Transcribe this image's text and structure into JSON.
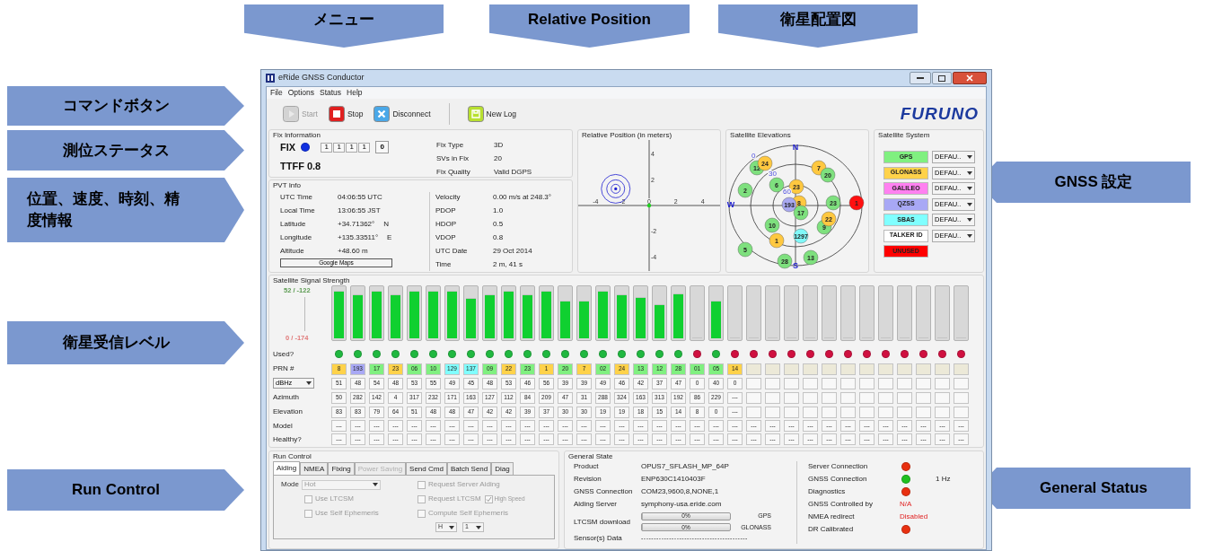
{
  "callouts": [
    {
      "text": "メニュー",
      "kind": "down"
    },
    {
      "text": "Relative Position",
      "kind": "down"
    },
    {
      "text": "衛星配置図",
      "kind": "down"
    },
    {
      "text": "コマンドボタン",
      "kind": "right"
    },
    {
      "text": "測位ステータス",
      "kind": "right"
    },
    {
      "text": "位置、速度、時刻、精度情報",
      "kind": "right"
    },
    {
      "text": "衛星受信レベル",
      "kind": "right"
    },
    {
      "text": "Run Control",
      "kind": "right"
    },
    {
      "text": "GNSS 設定",
      "kind": "left"
    },
    {
      "text": "General Status",
      "kind": "left"
    }
  ],
  "window": {
    "title": "eRide GNSS Conductor"
  },
  "menu": [
    "File",
    "Options",
    "Status",
    "Help"
  ],
  "toolbar": [
    {
      "label": "Start",
      "kind": "start",
      "disabled": true
    },
    {
      "label": "Stop",
      "kind": "stop",
      "disabled": false
    },
    {
      "label": "Disconnect",
      "kind": "disconnect",
      "disabled": false
    },
    {
      "label": "New Log",
      "kind": "log",
      "disabled": false
    }
  ],
  "logo": "FURUNO",
  "fix_information": {
    "title": "Fix Information",
    "status": "FIX",
    "boxes": [
      "1",
      "1",
      "1",
      "1"
    ],
    "count": "0",
    "ttff": "TTFF 0.8",
    "fields": [
      {
        "label": "Fix Type",
        "value": "3D"
      },
      {
        "label": "SVs in Fix",
        "value": "20"
      },
      {
        "label": "Fix Quality",
        "value": "Valid DGPS"
      }
    ]
  },
  "pvt_info": {
    "title": "PVT Info",
    "left": [
      {
        "label": "UTC Time",
        "value": "04:06:55 UTC"
      },
      {
        "label": "Local Time",
        "value": "13:06:55 JST"
      },
      {
        "label": "Latitude",
        "value": "+34.71362°",
        "suffix": "N"
      },
      {
        "label": "Longitude",
        "value": "+135.33511°",
        "suffix": "E"
      },
      {
        "label": "Altitude",
        "value": "+48.60 m"
      }
    ],
    "button": "Google Maps",
    "right": [
      {
        "label": "Velocity",
        "value": "0.00 m/s at 248.3°"
      },
      {
        "label": "PDOP",
        "value": "1.0"
      },
      {
        "label": "HDOP",
        "value": "0.5"
      },
      {
        "label": "VDOP",
        "value": "0.8"
      },
      {
        "label": "UTC Date",
        "value": "29 Oct 2014"
      },
      {
        "label": "Time",
        "value": "2 m, 41 s"
      }
    ]
  },
  "relative_position": {
    "chart_data": {
      "type": "scatter",
      "title": "Relative Position (in meters)",
      "x": [
        -2.5
      ],
      "series": [
        {
          "color": "#2020d0",
          "values": [
            1.3
          ]
        }
      ],
      "xlim": [
        -5.3,
        5.3
      ],
      "ylim": [
        -5.1,
        5.1
      ],
      "xticks": [
        -4,
        -2,
        0,
        2,
        4
      ],
      "yticks": [
        4,
        2,
        -2,
        -4
      ]
    }
  },
  "satellite_elevations": {
    "title": "Satellite Elevations",
    "directions": [
      "N",
      "W",
      "S"
    ],
    "rings": [
      "0",
      "30",
      "60"
    ],
    "satellites": [
      {
        "label": "12",
        "color": "#7ee07e"
      },
      {
        "label": "24",
        "color": "#ffc840"
      },
      {
        "label": "7",
        "color": "#ffc840"
      },
      {
        "label": "20",
        "color": "#7ee07e"
      },
      {
        "label": "2",
        "color": "#7ee07e"
      },
      {
        "label": "6",
        "color": "#7ee07e"
      },
      {
        "label": "8",
        "color": "#ffc840"
      },
      {
        "label": "17",
        "color": "#7ee07e"
      },
      {
        "label": "23",
        "color": "#ffc840"
      },
      {
        "label": "193",
        "color": "#a8a8f0"
      },
      {
        "label": "23",
        "color": "#7ee07e"
      },
      {
        "label": "1",
        "color": "#ff1010"
      },
      {
        "label": "9",
        "color": "#7ee07e"
      },
      {
        "label": "22",
        "color": "#ffc840"
      },
      {
        "label": "10",
        "color": "#7ee07e"
      },
      {
        "label": "1",
        "color": "#ffc840"
      },
      {
        "label": "1297",
        "color": "#80f8f8"
      },
      {
        "label": "5",
        "color": "#7ee07e"
      },
      {
        "label": "28",
        "color": "#7ee07e"
      },
      {
        "label": "13",
        "color": "#7ee07e"
      }
    ]
  },
  "satellite_system": {
    "title": "Satellite System",
    "systems": [
      {
        "name": "GPS",
        "color": "#80f080",
        "setting": "DEFAU.."
      },
      {
        "name": "GLONASS",
        "color": "#ffd24a",
        "setting": "DEFAU.."
      },
      {
        "name": "GALILEO",
        "color": "#ff80f0",
        "setting": "DEFAU.."
      },
      {
        "name": "QZSS",
        "color": "#a8a8f5",
        "setting": "DEFAU.."
      },
      {
        "name": "SBAS",
        "color": "#80ffff",
        "setting": "DEFAU.."
      },
      {
        "name": "TALKER ID",
        "color": "#ffffff",
        "setting": "DEFAU.."
      },
      {
        "name": "UNUSED",
        "color": "#ff0000"
      }
    ]
  },
  "signal_strength": {
    "title": "Satellite Signal Strength",
    "scale_top": "52 / -122",
    "scale_bottom": "0 / -174",
    "row_labels": {
      "used": "Used?",
      "prn": "PRN #",
      "unit": "dBHz",
      "azimuth": "Azimuth",
      "elevation": "Elevation",
      "model": "Model",
      "healthy": "Healthy?"
    },
    "satellites": [
      {
        "prn": "8",
        "color": "#ffd24a",
        "used": true,
        "level": 0.95,
        "cn0": "51",
        "azimuth": "50",
        "elevation": "83",
        "model": "---",
        "healthy": "---"
      },
      {
        "prn": "193",
        "color": "#a8a8f5",
        "used": true,
        "level": 0.88,
        "cn0": "48",
        "azimuth": "282",
        "elevation": "83",
        "model": "---",
        "healthy": "---"
      },
      {
        "prn": "17",
        "color": "#80f080",
        "used": true,
        "level": 0.95,
        "cn0": "54",
        "azimuth": "142",
        "elevation": "79",
        "model": "---",
        "healthy": "---"
      },
      {
        "prn": "23",
        "color": "#ffd24a",
        "used": true,
        "level": 0.88,
        "cn0": "48",
        "azimuth": "4",
        "elevation": "64",
        "model": "---",
        "healthy": "---"
      },
      {
        "prn": "06",
        "color": "#80f080",
        "used": true,
        "level": 0.95,
        "cn0": "53",
        "azimuth": "317",
        "elevation": "51",
        "model": "---",
        "healthy": "---"
      },
      {
        "prn": "10",
        "color": "#80f080",
        "used": true,
        "level": 0.95,
        "cn0": "55",
        "azimuth": "232",
        "elevation": "48",
        "model": "---",
        "healthy": "---"
      },
      {
        "prn": "129",
        "color": "#80ffff",
        "used": true,
        "level": 0.95,
        "cn0": "49",
        "azimuth": "171",
        "elevation": "48",
        "model": "---",
        "healthy": "---"
      },
      {
        "prn": "137",
        "color": "#80ffff",
        "used": true,
        "level": 0.8,
        "cn0": "45",
        "azimuth": "163",
        "elevation": "47",
        "model": "---",
        "healthy": "---"
      },
      {
        "prn": "09",
        "color": "#80f080",
        "used": true,
        "level": 0.88,
        "cn0": "48",
        "azimuth": "127",
        "elevation": "42",
        "model": "---",
        "healthy": "---"
      },
      {
        "prn": "22",
        "color": "#ffd24a",
        "used": true,
        "level": 0.95,
        "cn0": "53",
        "azimuth": "112",
        "elevation": "42",
        "model": "---",
        "healthy": "---"
      },
      {
        "prn": "23",
        "color": "#80f080",
        "used": true,
        "level": 0.88,
        "cn0": "46",
        "azimuth": "84",
        "elevation": "39",
        "model": "---",
        "healthy": "---"
      },
      {
        "prn": "1",
        "color": "#ffd24a",
        "used": true,
        "level": 0.95,
        "cn0": "56",
        "azimuth": "209",
        "elevation": "37",
        "model": "---",
        "healthy": "---"
      },
      {
        "prn": "20",
        "color": "#80f080",
        "used": true,
        "level": 0.75,
        "cn0": "39",
        "azimuth": "47",
        "elevation": "30",
        "model": "---",
        "healthy": "---"
      },
      {
        "prn": "7",
        "color": "#ffd24a",
        "used": true,
        "level": 0.75,
        "cn0": "39",
        "azimuth": "31",
        "elevation": "30",
        "model": "---",
        "healthy": "---"
      },
      {
        "prn": "02",
        "color": "#80f080",
        "used": true,
        "level": 0.95,
        "cn0": "49",
        "azimuth": "288",
        "elevation": "19",
        "model": "---",
        "healthy": "---"
      },
      {
        "prn": "24",
        "color": "#ffd24a",
        "used": true,
        "level": 0.88,
        "cn0": "46",
        "azimuth": "324",
        "elevation": "19",
        "model": "---",
        "healthy": "---"
      },
      {
        "prn": "13",
        "color": "#80f080",
        "used": true,
        "level": 0.82,
        "cn0": "42",
        "azimuth": "163",
        "elevation": "18",
        "model": "---",
        "healthy": "---"
      },
      {
        "prn": "12",
        "color": "#80f080",
        "used": true,
        "level": 0.67,
        "cn0": "37",
        "azimuth": "313",
        "elevation": "15",
        "model": "---",
        "healthy": "---"
      },
      {
        "prn": "28",
        "color": "#80f080",
        "used": true,
        "level": 0.9,
        "cn0": "47",
        "azimuth": "192",
        "elevation": "14",
        "model": "---",
        "healthy": "---"
      },
      {
        "prn": "01",
        "color": "#80f080",
        "used": false,
        "level": 0,
        "cn0": "0",
        "azimuth": "86",
        "elevation": "8",
        "model": "---",
        "healthy": "---"
      },
      {
        "prn": "05",
        "color": "#80f080",
        "used": true,
        "level": 0.75,
        "cn0": "40",
        "azimuth": "229",
        "elevation": "0",
        "model": "---",
        "healthy": "---"
      },
      {
        "prn": "14",
        "color": "#ffd24a",
        "used": false,
        "level": 0,
        "cn0": "0",
        "azimuth": "---",
        "elevation": "---",
        "model": "---",
        "healthy": "---"
      },
      {
        "color": "#ece9d8",
        "used": false,
        "level": 0,
        "model": "---",
        "healthy": "---"
      },
      {
        "color": "#ece9d8",
        "used": false,
        "level": 0,
        "model": "---",
        "healthy": "---"
      },
      {
        "color": "#ece9d8",
        "used": false,
        "level": 0,
        "model": "---",
        "healthy": "---"
      },
      {
        "color": "#ece9d8",
        "used": false,
        "level": 0,
        "model": "---",
        "healthy": "---"
      },
      {
        "color": "#ece9d8",
        "used": false,
        "level": 0,
        "model": "---",
        "healthy": "---"
      },
      {
        "color": "#ece9d8",
        "used": false,
        "level": 0,
        "model": "---",
        "healthy": "---"
      },
      {
        "color": "#ece9d8",
        "used": false,
        "level": 0,
        "model": "---",
        "healthy": "---"
      },
      {
        "color": "#ece9d8",
        "used": false,
        "level": 0,
        "model": "---",
        "healthy": "---"
      },
      {
        "color": "#ece9d8",
        "used": false,
        "level": 0,
        "model": "---",
        "healthy": "---"
      },
      {
        "color": "#ece9d8",
        "used": false,
        "level": 0,
        "model": "---",
        "healthy": "---"
      },
      {
        "color": "#ece9d8",
        "used": false,
        "level": 0,
        "model": "---",
        "healthy": "---"
      },
      {
        "color": "#ece9d8",
        "used": false,
        "level": 0,
        "model": "---",
        "healthy": "---"
      }
    ]
  },
  "run_control": {
    "title": "Run Control",
    "tabs": [
      {
        "label": "Aiding",
        "selected": true,
        "disabled": false
      },
      {
        "label": "NMEA",
        "selected": false,
        "disabled": false
      },
      {
        "label": "Fixing",
        "selected": false,
        "disabled": false
      },
      {
        "label": "Power Saving",
        "selected": false,
        "disabled": true
      },
      {
        "label": "Send Cmd",
        "selected": false,
        "disabled": false
      },
      {
        "label": "Batch Send",
        "selected": false,
        "disabled": false
      },
      {
        "label": "Diag",
        "selected": false,
        "disabled": false
      }
    ],
    "mode": {
      "label": "Mode",
      "value": "Hot"
    },
    "options_left": [
      {
        "label": "Use LTCSM",
        "checked": false
      },
      {
        "label": "Use Self Ephemeris",
        "checked": false
      }
    ],
    "options_right": [
      {
        "label": "Request Server Aiding",
        "checked": false
      },
      {
        "label": "Request LTCSM",
        "checked": false
      },
      {
        "label": "Compute Self Ephemeris",
        "checked": false
      }
    ],
    "high_speed": {
      "label": "High Speed",
      "checked": true
    },
    "selects": [
      "H",
      "1"
    ]
  },
  "general_state": {
    "title": "General State",
    "info": [
      {
        "label": "Product",
        "value": "OPUS7_SFLASH_MP_64P"
      },
      {
        "label": "Revision",
        "value": "ENP630C1410403F"
      },
      {
        "label": "GNSS Connection",
        "value": "COM23,9600,8,NONE,1"
      },
      {
        "label": "Aiding Server",
        "value": "symphony-usa.eride.com"
      }
    ],
    "download": {
      "label": "LTCSM download",
      "bars": [
        {
          "text": "0%",
          "level": 0,
          "system": "GPS"
        },
        {
          "text": "0%",
          "level": 0,
          "system": "GLONASS"
        }
      ]
    },
    "sensor": {
      "label": "Sensor(s) Data",
      "value": "------------------------------------------"
    },
    "status": [
      {
        "label": "Server Connection",
        "kind": "dot",
        "color": "#e83010"
      },
      {
        "label": "GNSS Connection",
        "kind": "dot",
        "color": "#20c020",
        "extra": "1 Hz"
      },
      {
        "label": "Diagnostics",
        "kind": "dot",
        "color": "#e83010"
      },
      {
        "label": "GNSS Controlled by",
        "kind": "text",
        "value": "N/A"
      },
      {
        "label": "NMEA redirect",
        "kind": "text",
        "value": "Disabled"
      },
      {
        "label": "DR Calibrated",
        "kind": "dot",
        "color": "#e83010"
      }
    ]
  }
}
